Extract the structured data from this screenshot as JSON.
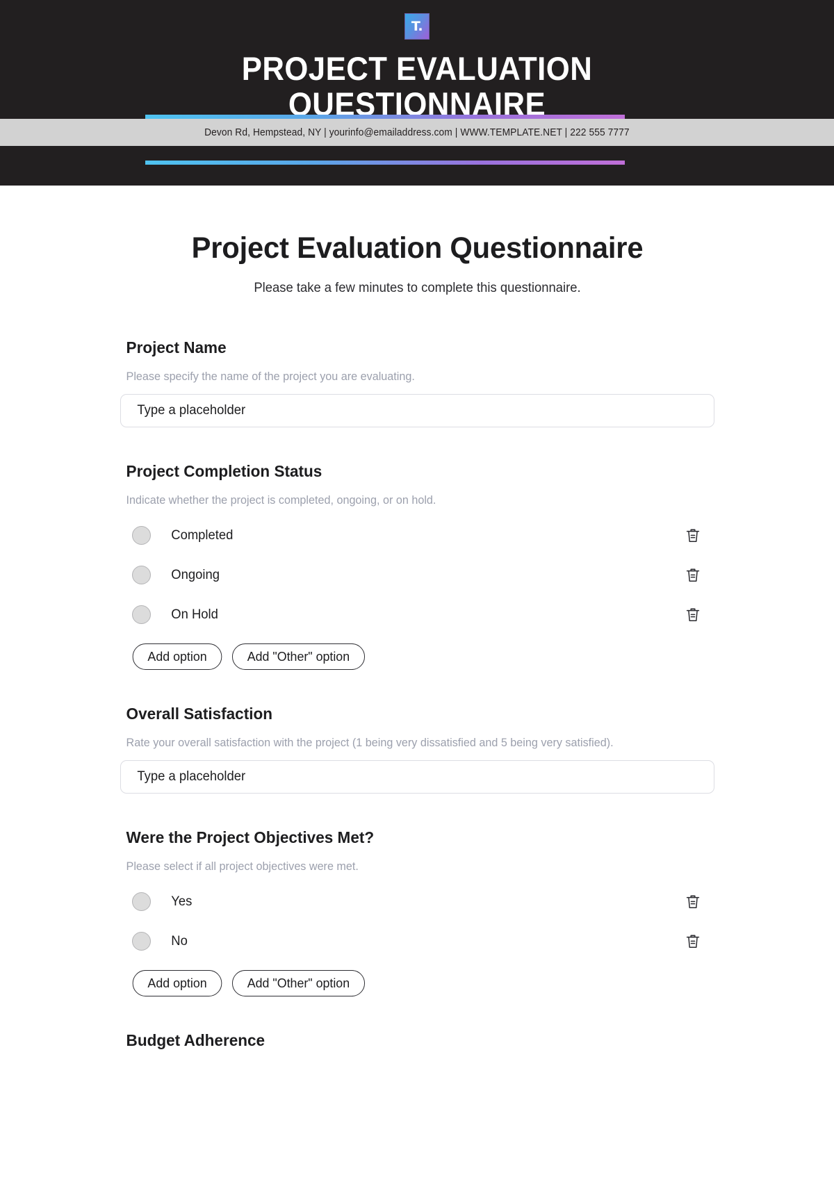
{
  "header": {
    "logo_glyph": "T.",
    "title_line1": "PROJECT EVALUATION",
    "title_line2": "QUESTIONNAIRE",
    "contact": "Devon Rd, Hempstead, NY | yourinfo@emailaddress.com | WWW.TEMPLATE.NET | 222 555 7777",
    "background_color": "#221f20",
    "strip_color": "#d2d2d2",
    "accent_gradient_start": "#4fc3f0",
    "accent_gradient_end": "#c06fd8"
  },
  "form": {
    "title": "Project Evaluation Questionnaire",
    "subtitle": "Please take a few minutes to complete this questionnaire.",
    "add_option_label": "Add option",
    "add_other_option_label": "Add \"Other\" option",
    "input_placeholder": "Type a placeholder",
    "questions": [
      {
        "label": "Project Name",
        "help": "Please specify the name of the project you are evaluating.",
        "type": "text",
        "value": "Type a placeholder"
      },
      {
        "label": "Project Completion Status",
        "help": "Indicate whether the project is completed, ongoing, or on hold.",
        "type": "radio",
        "options": [
          "Completed",
          "Ongoing",
          "On Hold"
        ]
      },
      {
        "label": "Overall Satisfaction",
        "help": "Rate your overall satisfaction with the project (1 being very dissatisfied and 5 being very satisfied).",
        "type": "text",
        "value": "Type a placeholder"
      },
      {
        "label": "Were the Project Objectives Met?",
        "help": "Please select if all project objectives were met.",
        "type": "radio",
        "options": [
          "Yes",
          "No"
        ]
      },
      {
        "label": "Budget Adherence",
        "type": "text"
      }
    ]
  }
}
